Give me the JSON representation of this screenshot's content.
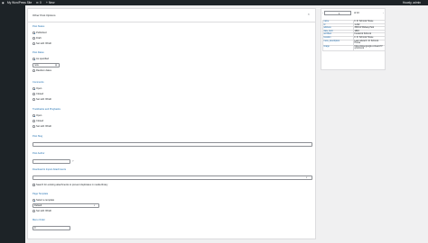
{
  "adminbar": {
    "site_name": "My WordPress Site",
    "comments_count": "0",
    "new_label": "New",
    "howdy": "Howdy, admin"
  },
  "panel": {
    "title": "Other Post Options",
    "close_glyph": "×",
    "post_status": {
      "heading": "Post Status",
      "options": [
        "Published",
        "Draft",
        "Set with XPath"
      ],
      "selected": 0
    },
    "post_dates": {
      "heading": "Post Dates",
      "options": [
        "As specified",
        "Random dates"
      ],
      "date_value": "now",
      "calendar_icon": "calendar-icon"
    },
    "comments": {
      "heading": "Comments",
      "options": [
        "Open",
        "Closed",
        "Set with XPath"
      ],
      "selected": 0
    },
    "trackbacks": {
      "heading": "Trackbacks and Pingbacks",
      "options": [
        "Open",
        "Closed",
        "Set with XPath"
      ],
      "selected": 0
    },
    "post_slug": {
      "heading": "Post Slug",
      "value": ""
    },
    "post_author": {
      "heading": "Post Author",
      "value": ""
    },
    "attachments": {
      "heading": "Download & Import Attachments",
      "checkbox_label": "Search for existing attachments to prevent duplicates in media library"
    },
    "page_template": {
      "heading": "Page Template",
      "options": [
        "Select a template",
        "Set with XPath"
      ],
      "selected": 0,
      "select_value": "Default"
    },
    "menu_order": {
      "heading": "Menu Order",
      "value": "0"
    }
  },
  "record_nav": {
    "current": "1",
    "total_label": "of 10",
    "rows": [
      {
        "key": "name",
        "value": "F. R. Schrock House"
      },
      {
        "key": "id",
        "value": "1-222"
      },
      {
        "key": "address",
        "value": "3509 W Midway Park"
      },
      {
        "key": "date_built",
        "value": "1893"
      },
      {
        "key": "architect",
        "value": "Frederick Schrock"
      },
      {
        "key": "location",
        "value": "F. R. Schrock House"
      },
      {
        "key": "more_description",
        "value": "Learn about F. R. Schrock House"
      },
      {
        "key": "image",
        "value": "https://www.google.co/search?q=schrock"
      }
    ]
  },
  "colors": {
    "accent": "#2271b1",
    "adminbar": "#1d2327",
    "background": "#f0f0f1"
  }
}
